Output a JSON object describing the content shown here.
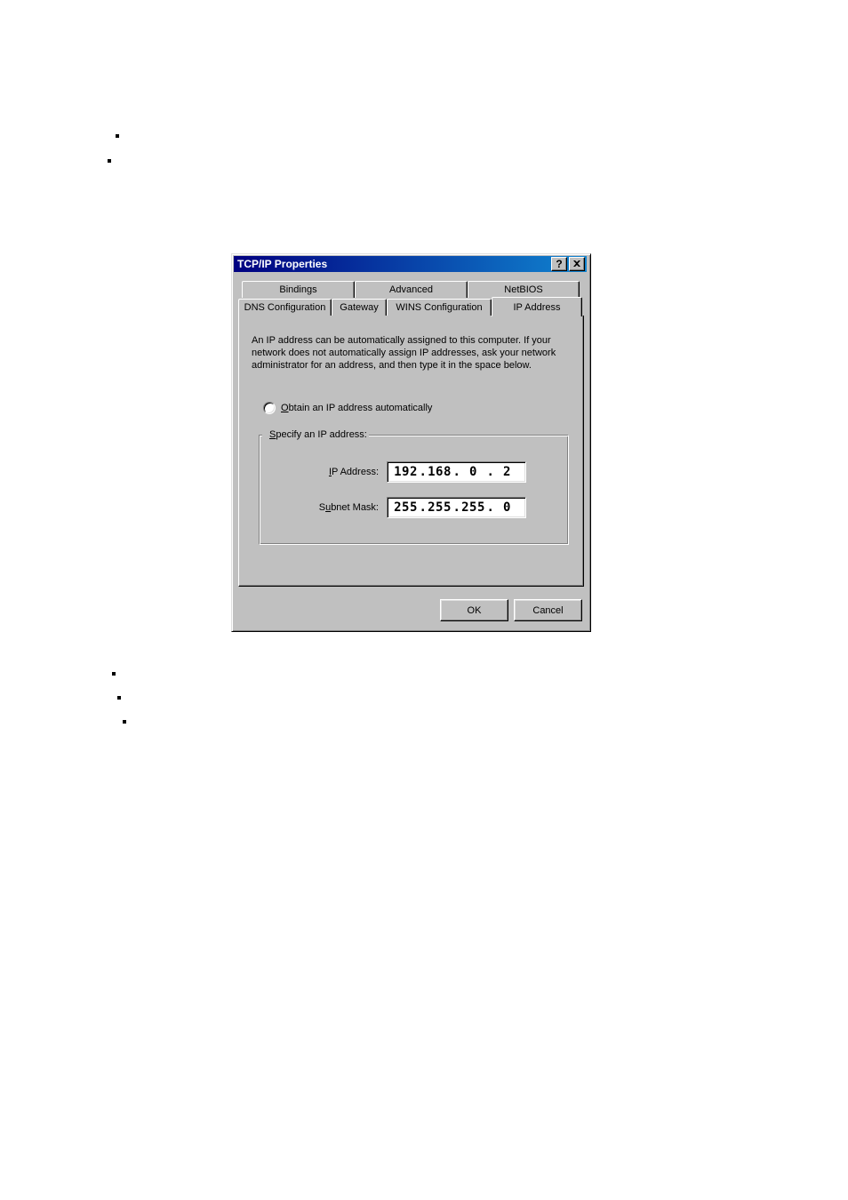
{
  "dialog": {
    "title": "TCP/IP Properties",
    "tabs_row1": [
      "Bindings",
      "Advanced",
      "NetBIOS"
    ],
    "tabs_row2": [
      "DNS Configuration",
      "Gateway",
      "WINS Configuration",
      "IP Address"
    ],
    "active_tab": "IP Address",
    "help_text": "An IP address can be automatically assigned to this computer. If your network does not automatically assign IP addresses, ask your network administrator for an address, and then type it in the space below.",
    "radio": {
      "obtain": {
        "label_pre": "O",
        "label_rest": "btain an IP address automatically",
        "selected": false
      },
      "specify": {
        "label_pre": "S",
        "label_rest": "pecify an IP address:",
        "selected": true
      }
    },
    "fields": {
      "ip_label_pre": "I",
      "ip_label_rest": "P Address:",
      "subnet_label_pre": "u",
      "subnet_label_prefix": "S",
      "subnet_label_rest": "bnet Mask:",
      "ip": {
        "o1": "192",
        "o2": "168",
        "o3": "0",
        "o4": "2"
      },
      "subnet": {
        "o1": "255",
        "o2": "255",
        "o3": "255",
        "o4": "0"
      }
    },
    "buttons": {
      "ok": "OK",
      "cancel": "Cancel"
    }
  }
}
